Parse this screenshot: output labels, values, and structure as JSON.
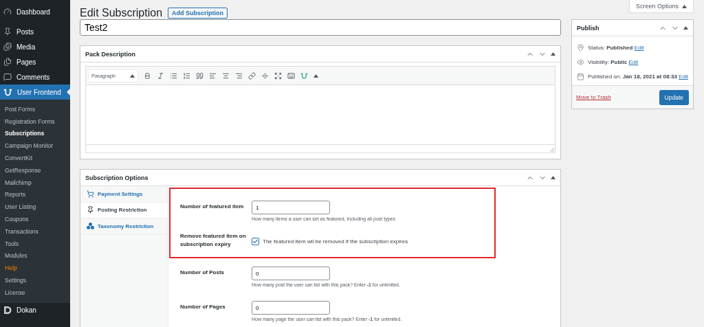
{
  "sidebar": {
    "menu": [
      {
        "label": "Dashboard",
        "selected": false
      },
      {
        "label": "Posts",
        "selected": false
      },
      {
        "label": "Media",
        "selected": false
      },
      {
        "label": "Pages",
        "selected": false
      },
      {
        "label": "Comments",
        "selected": false
      },
      {
        "label": "User Frontend",
        "selected": true,
        "children": [
          {
            "label": "Post Forms",
            "selected": false,
            "highlight": false
          },
          {
            "label": "Registration Forms",
            "selected": false,
            "highlight": false
          },
          {
            "label": "Subscriptions",
            "selected": true,
            "highlight": false
          },
          {
            "label": "Campaign Monitor",
            "selected": false,
            "highlight": false
          },
          {
            "label": "ConvertKit",
            "selected": false,
            "highlight": false
          },
          {
            "label": "GetResponse",
            "selected": false,
            "highlight": false
          },
          {
            "label": "Mailchimp",
            "selected": false,
            "highlight": false
          },
          {
            "label": "Reports",
            "selected": false,
            "highlight": false
          },
          {
            "label": "User Listing",
            "selected": false,
            "highlight": false
          },
          {
            "label": "Coupons",
            "selected": false,
            "highlight": false
          },
          {
            "label": "Transactions",
            "selected": false,
            "highlight": false
          },
          {
            "label": "Tools",
            "selected": false,
            "highlight": false
          },
          {
            "label": "Modules",
            "selected": false,
            "highlight": false
          },
          {
            "label": "Help",
            "selected": false,
            "highlight": true
          },
          {
            "label": "Settings",
            "selected": false,
            "highlight": false
          },
          {
            "label": "License",
            "selected": false,
            "highlight": false
          }
        ]
      },
      {
        "label": "Dokan",
        "selected": false
      }
    ]
  },
  "header": {
    "title": "Edit Subscription",
    "add_button": "Add Subscription",
    "screen_options": "Screen Options"
  },
  "title_field": {
    "value": "Test2"
  },
  "pack_description": {
    "title": "Pack Description",
    "format": "Paragraph"
  },
  "publish": {
    "title": "Publish",
    "rows": [
      {
        "label": "Status:",
        "value": "Published",
        "link": "Edit"
      },
      {
        "label": "Visibility:",
        "value": "Public",
        "link": "Edit"
      },
      {
        "label": "Published on:",
        "value": "Jan 18, 2021 at 08:33",
        "link": "Edit"
      }
    ],
    "trash": "Move to Trash",
    "update": "Update"
  },
  "subscription_options": {
    "title": "Subscription Options",
    "tabs": [
      {
        "label": "Payment Settings",
        "selected": false
      },
      {
        "label": "Posting Restriction",
        "selected": true
      },
      {
        "label": "Taxonomy Restriction",
        "selected": false
      }
    ],
    "featured_group": {
      "outlined": true,
      "fields": [
        {
          "kind": "number",
          "label": "Number of featured item",
          "value": "1",
          "help": "How many items a user can set as featured, including all post types"
        },
        {
          "kind": "checkbox",
          "label": "Remove featured item on subscription expiry",
          "checked": true,
          "text": "The featured item wil be removed if the subscription expires"
        }
      ]
    },
    "fields": [
      {
        "kind": "number",
        "label": "Number of Posts",
        "value": "0",
        "help": "How many post the user can list with this pack? Enter **-1** for unlimited."
      },
      {
        "kind": "number",
        "label": "Number of Pages",
        "value": "0",
        "help": "How many page the user can list with this pack? Enter **-1** for unlimited."
      }
    ]
  }
}
